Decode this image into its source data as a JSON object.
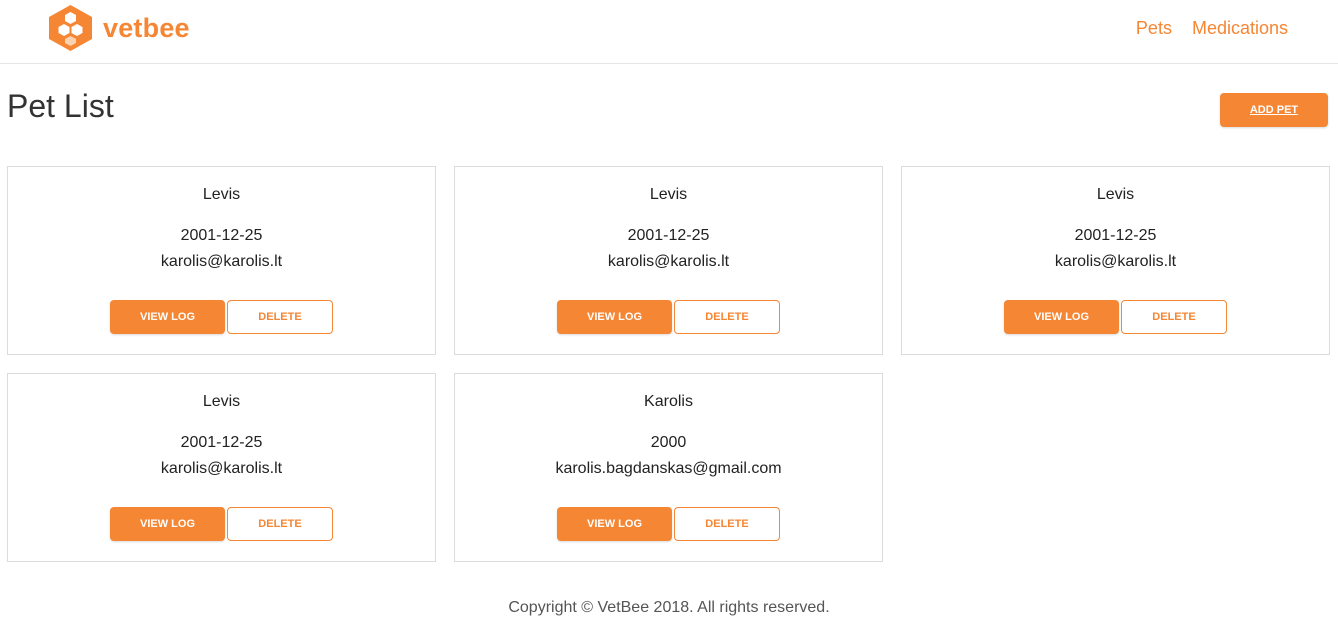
{
  "header": {
    "logo_text": "vetbee",
    "nav": [
      {
        "label": "Pets"
      },
      {
        "label": "Medications"
      }
    ]
  },
  "main": {
    "title": "Pet List",
    "add_button_label": "ADD PET",
    "pets": [
      {
        "name": "Levis",
        "dob": "2001-12-25",
        "email": "karolis@karolis.lt",
        "view_label": "VIEW LOG",
        "delete_label": "DELETE"
      },
      {
        "name": "Levis",
        "dob": "2001-12-25",
        "email": "karolis@karolis.lt",
        "view_label": "VIEW LOG",
        "delete_label": "DELETE"
      },
      {
        "name": "Levis",
        "dob": "2001-12-25",
        "email": "karolis@karolis.lt",
        "view_label": "VIEW LOG",
        "delete_label": "DELETE"
      },
      {
        "name": "Levis",
        "dob": "2001-12-25",
        "email": "karolis@karolis.lt",
        "view_label": "VIEW LOG",
        "delete_label": "DELETE"
      },
      {
        "name": "Karolis",
        "dob": "2000",
        "email": "karolis.bagdanskas@gmail.com",
        "view_label": "VIEW LOG",
        "delete_label": "DELETE"
      }
    ]
  },
  "footer": {
    "text": "Copyright © VetBee 2018. All rights reserved."
  },
  "colors": {
    "accent": "#f58634",
    "border": "#dcdcdc"
  },
  "icons": {
    "logo": "honeycomb-logo-icon"
  }
}
